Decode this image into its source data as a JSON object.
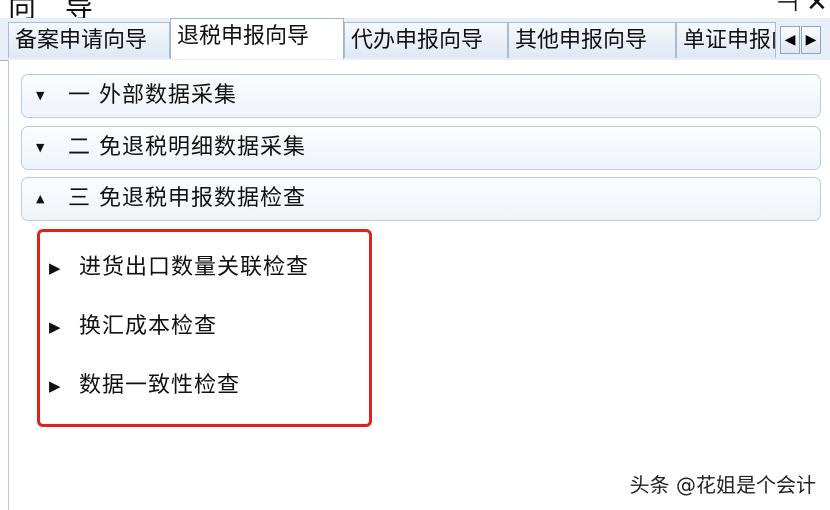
{
  "window": {
    "title": "向 导",
    "pin_glyph": "⊣",
    "close_glyph": "✕"
  },
  "tabs": [
    {
      "label": "备案申请向导",
      "active": false
    },
    {
      "label": "退税申报向导",
      "active": true
    },
    {
      "label": "代办申报向导",
      "active": false
    },
    {
      "label": "其他申报向导",
      "active": false
    },
    {
      "label": "单证申报向导",
      "active": false
    }
  ],
  "tab_scroll": {
    "left_glyph": "◀",
    "right_glyph": "▶"
  },
  "sections": [
    {
      "label": "一  外部数据采集",
      "expanded": false,
      "arrow_glyph": "▼"
    },
    {
      "label": "二  免退税明细数据采集",
      "expanded": false,
      "arrow_glyph": "▼"
    },
    {
      "label": "三  免退税申报数据检查",
      "expanded": true,
      "arrow_glyph": "▲"
    }
  ],
  "sub_items": [
    {
      "label": "进货出口数量关联检查",
      "arrow_glyph": "▶"
    },
    {
      "label": "换汇成本检查",
      "arrow_glyph": "▶"
    },
    {
      "label": "数据一致性检查",
      "arrow_glyph": "▶"
    }
  ],
  "watermark": "头条 @花姐是个会计",
  "colors": {
    "highlight_border": "#e0211c",
    "tab_bar_bg": "#e7eff8",
    "section_border": "#b9cde3"
  }
}
